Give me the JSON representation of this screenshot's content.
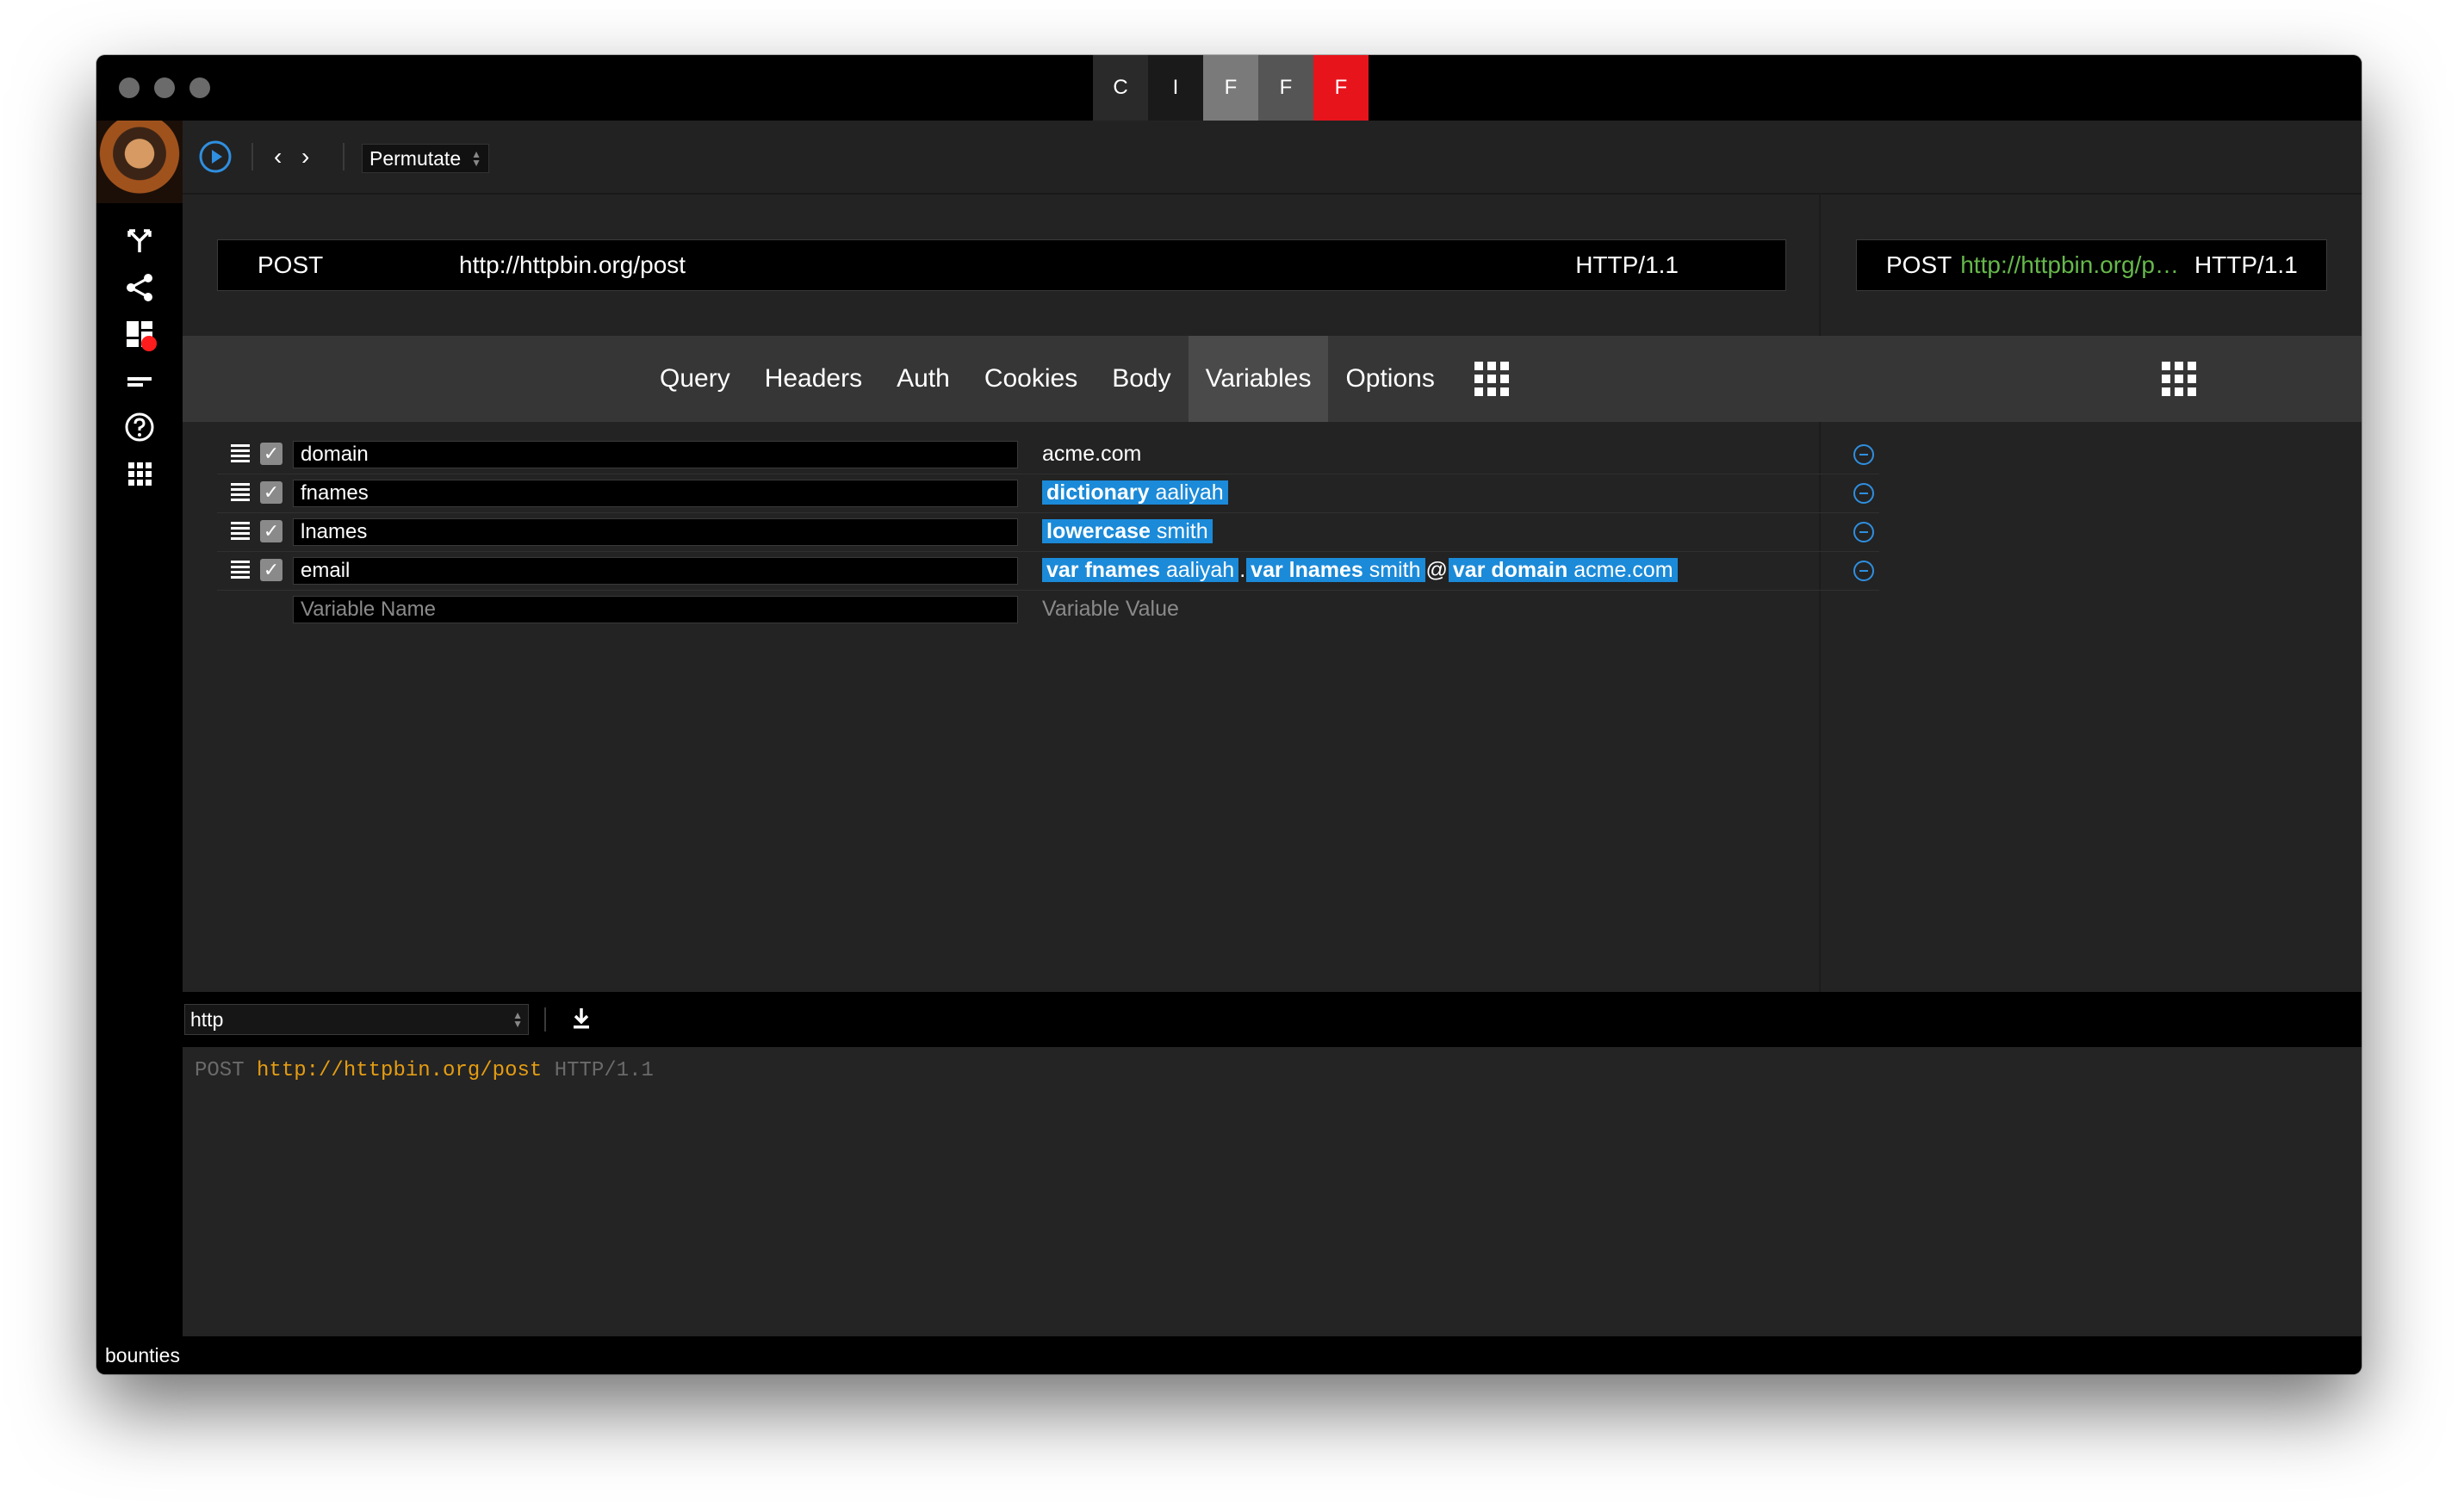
{
  "titlebar": {
    "modes": [
      "C",
      "I",
      "F",
      "F",
      "F"
    ]
  },
  "toolbar": {
    "mode_select": "Permutate"
  },
  "request": {
    "method": "POST",
    "url": "http://httpbin.org/post",
    "protocol": "HTTP/1.1",
    "preview_method": "POST",
    "preview_url": "http://httpbin.org/p…",
    "preview_protocol": "HTTP/1.1"
  },
  "tabs": [
    "Query",
    "Headers",
    "Auth",
    "Cookies",
    "Body",
    "Variables",
    "Options"
  ],
  "active_tab": "Variables",
  "variables": [
    {
      "name": "domain",
      "value_plain": "acme.com"
    },
    {
      "name": "fnames",
      "token_kind": "dictionary",
      "token_value": "aaliyah"
    },
    {
      "name": "lnames",
      "token_kind": "lowercase",
      "token_value": "smith"
    },
    {
      "name": "email",
      "tok1_kind": "var fnames",
      "tok1_value": "aaliyah",
      "dot": ".",
      "tok2_kind": "var lnames",
      "tok2_value": "smith",
      "at": "@",
      "tok3_kind": "var domain",
      "tok3_value": "acme.com"
    }
  ],
  "new_variable": {
    "name_placeholder": "Variable Name",
    "value_placeholder": "Variable Value"
  },
  "output": {
    "format": "http",
    "line_method": "POST",
    "line_url": "http://httpbin.org/post",
    "line_protocol": "HTTP/1.1"
  },
  "status_text": "bounties",
  "colors": {
    "token": "#1b8ad8",
    "accent_red": "#e8141c",
    "url_green": "#66b84b",
    "code_url": "#e59d12"
  }
}
